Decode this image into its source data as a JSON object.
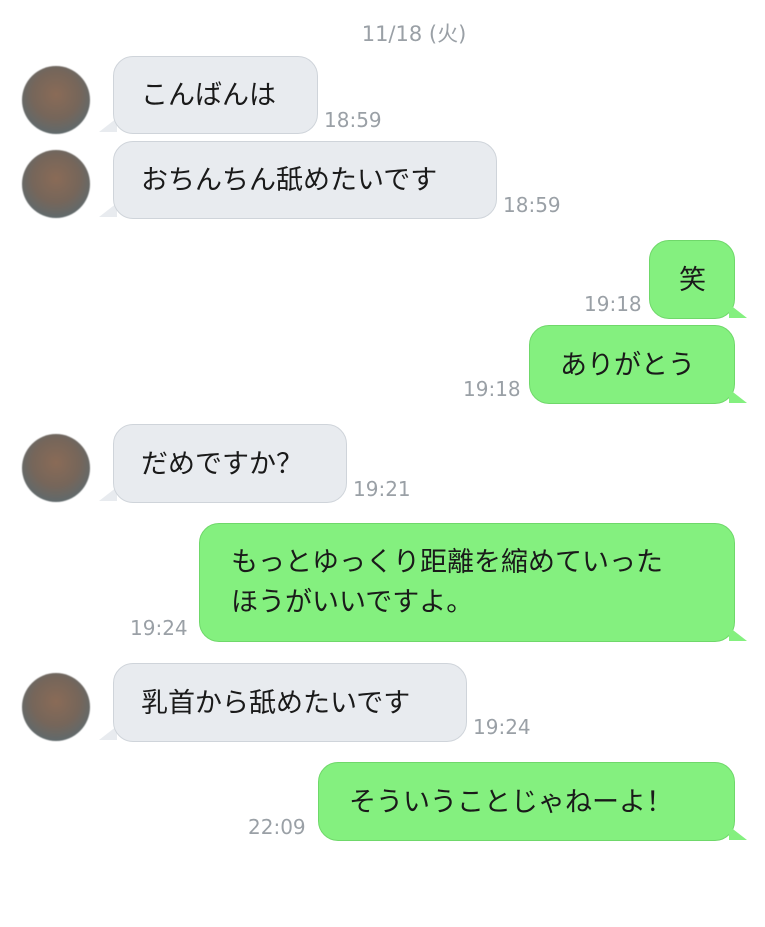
{
  "date_header": "11/18 (火)",
  "messages": [
    {
      "side": "in",
      "text": "こんばんは",
      "time": "18:59"
    },
    {
      "side": "in",
      "text": "おちんちん舐めたいです",
      "time": "18:59"
    },
    {
      "side": "out",
      "text": "笑",
      "time": "19:18"
    },
    {
      "side": "out",
      "text": "ありがとう",
      "time": "19:18"
    },
    {
      "side": "in",
      "text": "だめですか？",
      "time": "19:21"
    },
    {
      "side": "out",
      "lines": [
        "もっとゆっくり距離を縮めていった",
        "ほうがいいですよ。"
      ],
      "time": "19:24"
    },
    {
      "side": "in",
      "text": "乳首から舐めたいです",
      "time": "19:24"
    },
    {
      "side": "out",
      "text": "そういうことじゃねーよ！",
      "time": "22:09"
    }
  ]
}
